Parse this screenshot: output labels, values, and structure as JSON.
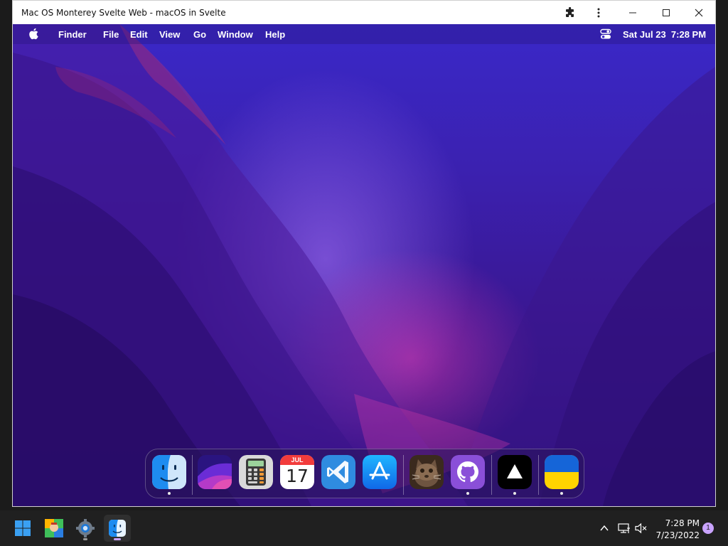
{
  "browser": {
    "title": "Mac OS Monterey Svelte Web - macOS in Svelte",
    "icons": [
      "extensions-icon",
      "more-menu-icon",
      "minimize-icon",
      "maximize-icon",
      "close-icon"
    ]
  },
  "mac_menubar": {
    "apple_icon": "apple-icon",
    "items": [
      "Finder",
      "File",
      "Edit",
      "View",
      "Go",
      "Window",
      "Help"
    ],
    "control_center_icon": "control-center-icon",
    "datetime": "Sat Jul 23  7:28 PM"
  },
  "dock": {
    "apps": [
      {
        "name": "Finder",
        "icon": "finder-icon",
        "running": true
      },
      {
        "name": "Wallpapers",
        "icon": "wallpapers-icon",
        "running": false
      },
      {
        "name": "Calculator",
        "icon": "calculator-icon",
        "running": false
      },
      {
        "name": "Calendar",
        "icon": "calendar-icon",
        "running": false,
        "month": "JUL",
        "day": "17"
      },
      {
        "name": "VS Code",
        "icon": "vscode-icon",
        "running": false
      },
      {
        "name": "App Store",
        "icon": "app-store-icon",
        "running": false
      },
      {
        "name": "Cat",
        "icon": "cat-photo-icon",
        "running": false
      },
      {
        "name": "GitHub",
        "icon": "github-icon",
        "running": true
      },
      {
        "name": "Vercel",
        "icon": "vercel-icon",
        "running": true
      },
      {
        "name": "Ukraine",
        "icon": "ukraine-flag-icon",
        "running": true
      }
    ]
  },
  "taskbar": {
    "apps": [
      "windows-start-icon",
      "app-icon",
      "settings-icon",
      "finder-icon"
    ],
    "tray_icons": [
      "chevron-up-icon",
      "network-icon",
      "volume-muted-icon"
    ],
    "time": "7:28 PM",
    "date": "7/23/2022",
    "notification_count": "1"
  },
  "colors": {
    "wallpaper_top": "#3a28c8",
    "wallpaper_bottom": "#2d0f74",
    "accent_pink": "#e63cb4",
    "taskbar": "#202020",
    "notification_badge": "#c9a3ff"
  }
}
